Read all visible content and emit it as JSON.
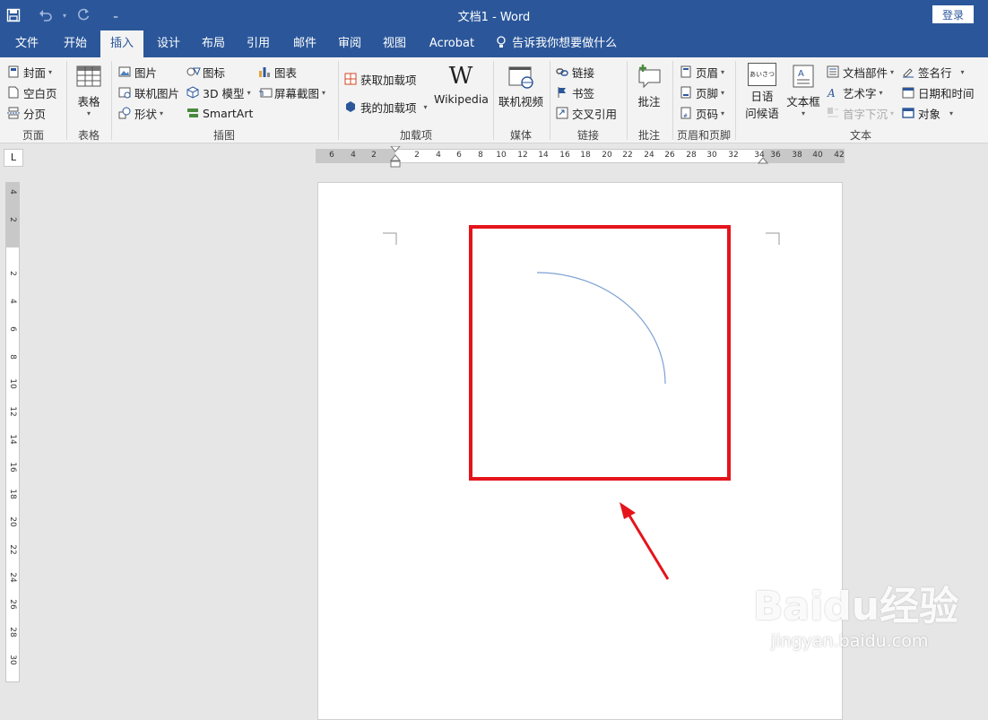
{
  "window": {
    "title": "文档1  -  Word",
    "login": "登录"
  },
  "qat": {
    "save": "save-icon",
    "undo": "undo-icon",
    "redo": "redo-icon",
    "customize": "customize-icon"
  },
  "tabs": [
    "文件",
    "开始",
    "插入",
    "设计",
    "布局",
    "引用",
    "邮件",
    "审阅",
    "视图",
    "Acrobat"
  ],
  "active_tab": "插入",
  "tell_me": "告诉我你想要做什么",
  "ribbon": {
    "pages": {
      "label": "页面",
      "items": [
        "封面",
        "空白页",
        "分页"
      ]
    },
    "tables": {
      "label": "表格",
      "button": "表格"
    },
    "illustrations": {
      "label": "插图",
      "items": [
        "图片",
        "联机图片",
        "形状",
        "图标",
        "3D 模型",
        "SmartArt",
        "图表",
        "屏幕截图"
      ]
    },
    "addins": {
      "label": "加载项",
      "items": [
        "获取加载项",
        "我的加载项"
      ],
      "wikipedia": "Wikipedia",
      "wiki_glyph": "W"
    },
    "media": {
      "label": "媒体",
      "button": "联机视频"
    },
    "links": {
      "label": "链接",
      "items": [
        "链接",
        "书签",
        "交叉引用"
      ]
    },
    "comments": {
      "label": "批注",
      "button": "批注"
    },
    "header_footer": {
      "label": "页眉和页脚",
      "items": [
        "页眉",
        "页脚",
        "页码"
      ]
    },
    "text": {
      "label": "文本",
      "japanese_line1": "日语",
      "japanese_line2": "问候语",
      "japanese_icon_text": "あいさつ",
      "textbox": "文本框",
      "items": [
        "文档部件",
        "艺术字",
        "首字下沉",
        "签名行",
        "日期和时间",
        "对象"
      ]
    }
  },
  "rulers": {
    "horizontal": [
      "6",
      "4",
      "2",
      "2",
      "4",
      "6",
      "8",
      "10",
      "12",
      "14",
      "16",
      "18",
      "20",
      "22",
      "24",
      "26",
      "28",
      "30",
      "32",
      "34",
      "36",
      "38",
      "40",
      "42"
    ],
    "vertical": [
      "4",
      "2",
      "2",
      "4",
      "6",
      "8",
      "10",
      "12",
      "14",
      "16",
      "18",
      "20",
      "22",
      "24",
      "26",
      "28",
      "30"
    ],
    "tab_selector": "L"
  },
  "annotation": {
    "highlight_color": "#e5141b",
    "arc_color": "#7da1d4"
  },
  "watermark": {
    "logo": "Baidu经验",
    "url": "jingyan.baidu.com"
  }
}
